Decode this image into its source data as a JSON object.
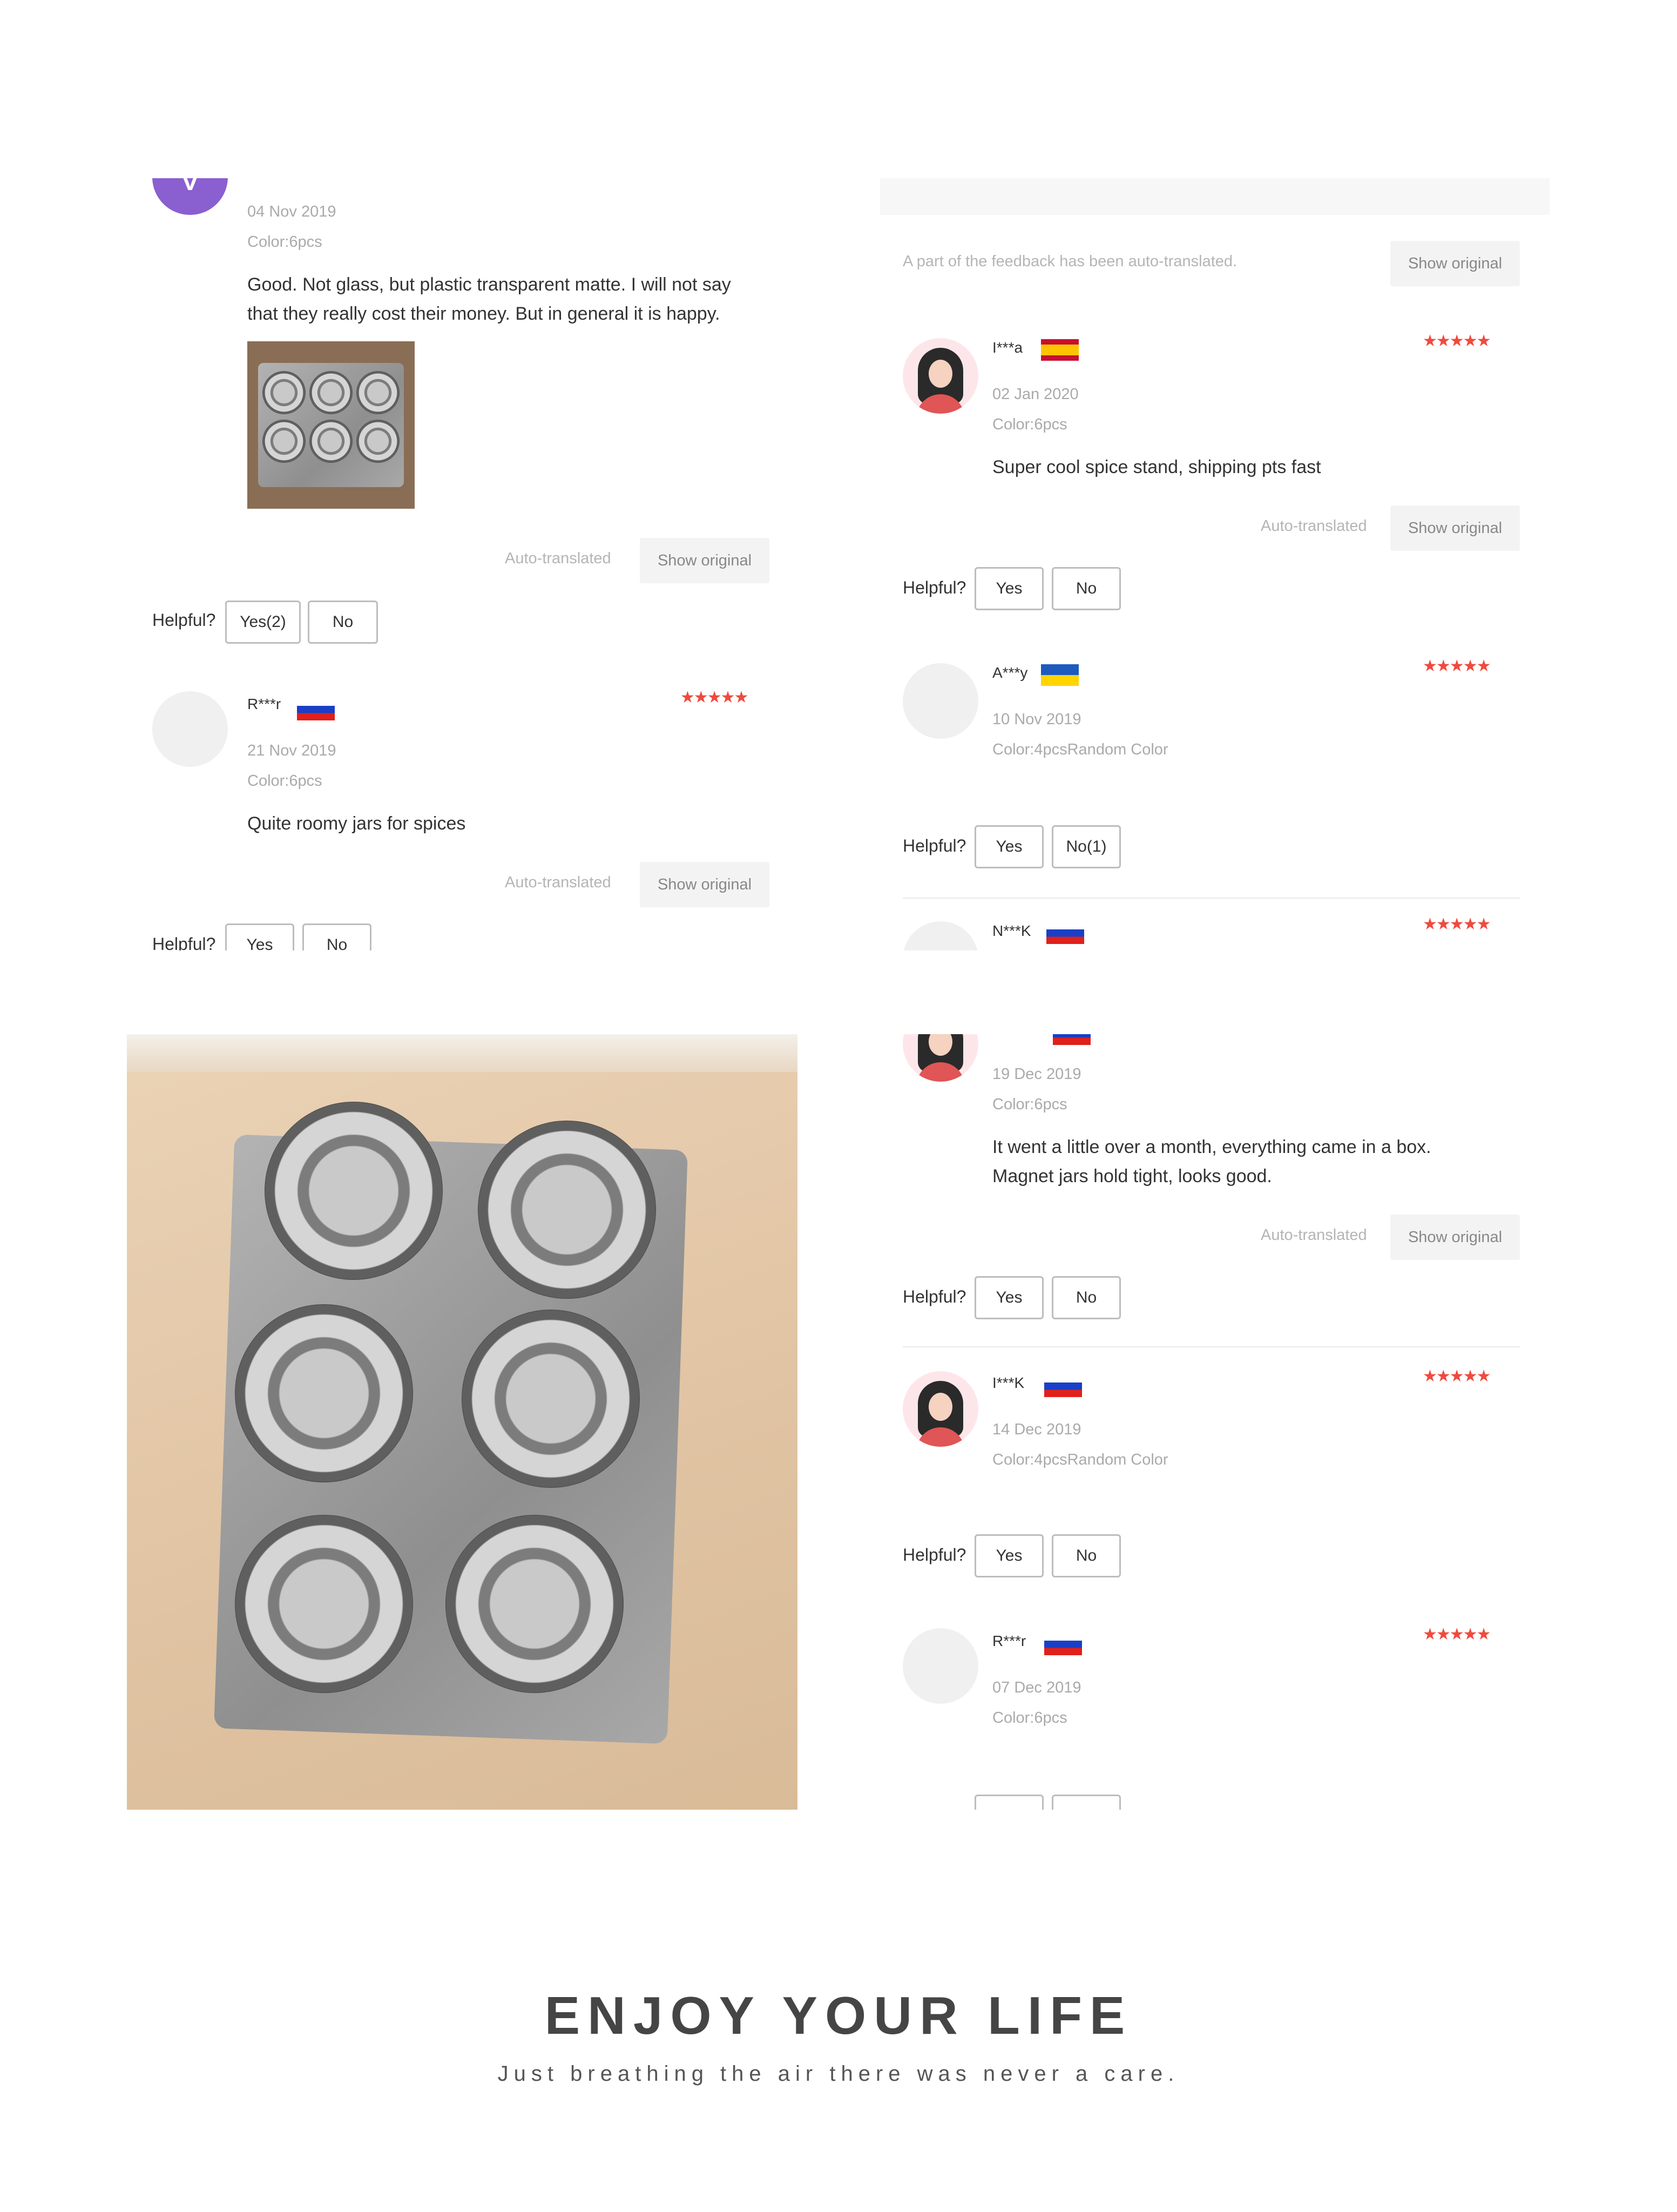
{
  "left_panel": {
    "review1": {
      "avatar_letter": "V",
      "date": "04 Nov 2019",
      "color": "Color:6pcs",
      "text_line1": "Good. Not glass, but plastic transparent matte. I will not say",
      "text_line2": "that they really cost their money. But in general it is happy.",
      "auto_translated": "Auto-translated",
      "show_original": "Show original",
      "helpful_label": "Helpful?",
      "yes_label": "Yes(2)",
      "no_label": "No"
    },
    "review2": {
      "name": "R***r",
      "stars": "★★★★★",
      "date": "21 Nov 2019",
      "color": "Color:6pcs",
      "text": "Quite roomy jars for spices",
      "auto_translated": "Auto-translated",
      "show_original": "Show original",
      "helpful_label": "Helpful?",
      "yes_label": "Yes",
      "no_label": "No"
    }
  },
  "right_panel_top": {
    "notice": "A part of the feedback has been auto-translated.",
    "show_original": "Show original",
    "review1": {
      "name": "I***a",
      "stars": "★★★★★",
      "date": "02 Jan 2020",
      "color": "Color:6pcs",
      "text": "Super cool spice stand, shipping pts fast",
      "auto_translated": "Auto-translated",
      "show_original": "Show original",
      "helpful_label": "Helpful?",
      "yes_label": "Yes",
      "no_label": "No"
    },
    "review2": {
      "name": "A***y",
      "stars": "★★★★★",
      "date": "10 Nov 2019",
      "color": "Color:4pcsRandom Color",
      "helpful_label": "Helpful?",
      "yes_label": "Yes",
      "no_label": "No(1)"
    },
    "review3": {
      "name": "N***K",
      "stars": "★★★★★"
    }
  },
  "right_panel_bottom": {
    "review1": {
      "date": "19 Dec 2019",
      "color": "Color:6pcs",
      "text_line1": "It went a little over a month, everything came in a box.",
      "text_line2": "Magnet jars hold tight, looks good.",
      "auto_translated": "Auto-translated",
      "show_original": "Show original",
      "helpful_label": "Helpful?",
      "yes_label": "Yes",
      "no_label": "No"
    },
    "review2": {
      "name": "I***K",
      "stars": "★★★★★",
      "date": "14 Dec 2019",
      "color": "Color:4pcsRandom Color",
      "helpful_label": "Helpful?",
      "yes_label": "Yes",
      "no_label": "No"
    },
    "review3": {
      "name": "R***r",
      "stars": "★★★★★",
      "date": "07 Dec 2019",
      "color": "Color:6pcs"
    }
  },
  "footer": {
    "title": "ENJOY YOUR LIFE",
    "subtitle": "Just breathing the air there was never a care."
  },
  "colors": {
    "star": "#f04a3e",
    "avatar_letter_bg": "#8a5fd0",
    "photo_background": "#e2c7a8"
  }
}
